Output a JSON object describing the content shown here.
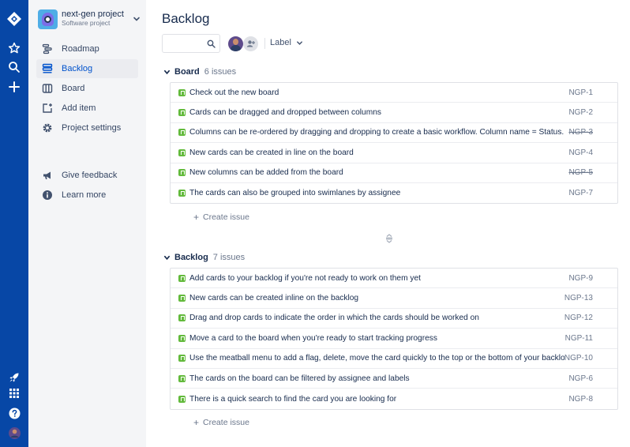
{
  "project": {
    "name": "next-gen project",
    "type": "Software project"
  },
  "sidebar": {
    "items": [
      {
        "label": "Roadmap",
        "icon": "roadmap-icon"
      },
      {
        "label": "Backlog",
        "icon": "backlog-icon",
        "active": true
      },
      {
        "label": "Board",
        "icon": "board-icon"
      },
      {
        "label": "Add item",
        "icon": "add-item-icon"
      },
      {
        "label": "Project settings",
        "icon": "gear-icon"
      },
      {
        "label": "Give feedback",
        "icon": "megaphone-icon"
      },
      {
        "label": "Learn more",
        "icon": "info-icon"
      }
    ]
  },
  "page": {
    "title": "Backlog"
  },
  "filters": {
    "search_placeholder": "",
    "label_filter": "Label"
  },
  "board": {
    "name": "Board",
    "count": "6 issues",
    "issues": [
      {
        "summary": "Check out the new board",
        "key": "NGP-1",
        "done": false
      },
      {
        "summary": "Cards can be dragged and dropped between columns",
        "key": "NGP-2",
        "done": false
      },
      {
        "summary": "Columns can be re-ordered by dragging and dropping to create a basic workflow. Column name = Status.",
        "key": "NGP-3",
        "done": true
      },
      {
        "summary": "New cards can be created in line on the board",
        "key": "NGP-4",
        "done": false
      },
      {
        "summary": "New columns can be added from the board",
        "key": "NGP-5",
        "done": true
      },
      {
        "summary": "The cards can also be grouped into swimlanes by assignee",
        "key": "NGP-7",
        "done": false
      }
    ],
    "create_label": "Create issue"
  },
  "backlog": {
    "name": "Backlog",
    "count": "7 issues",
    "issues": [
      {
        "summary": "Add cards to your backlog if you're not ready to work on them yet",
        "key": "NGP-9",
        "done": false
      },
      {
        "summary": "New cards can be created inline on the backlog",
        "key": "NGP-13",
        "done": false
      },
      {
        "summary": "Drag and drop cards to indicate the order in which the cards should be worked on",
        "key": "NGP-12",
        "done": false
      },
      {
        "summary": "Move a card to the board when you're ready to start tracking progress",
        "key": "NGP-11",
        "done": false
      },
      {
        "summary": "Use the meatball menu to add a flag, delete, move the card quickly to the top or the bottom of your backlog",
        "key": "NGP-10",
        "done": false
      },
      {
        "summary": "The cards on the board can be filtered by assignee and labels",
        "key": "NGP-6",
        "done": false
      },
      {
        "summary": "There is a quick search to find the card you are looking for",
        "key": "NGP-8",
        "done": false
      }
    ],
    "create_label": "Create issue"
  },
  "colors": {
    "global_nav": "#0747a6",
    "sidebar_bg": "#f4f5f7",
    "story_green": "#63ba3c",
    "active_blue": "#0052cc"
  }
}
